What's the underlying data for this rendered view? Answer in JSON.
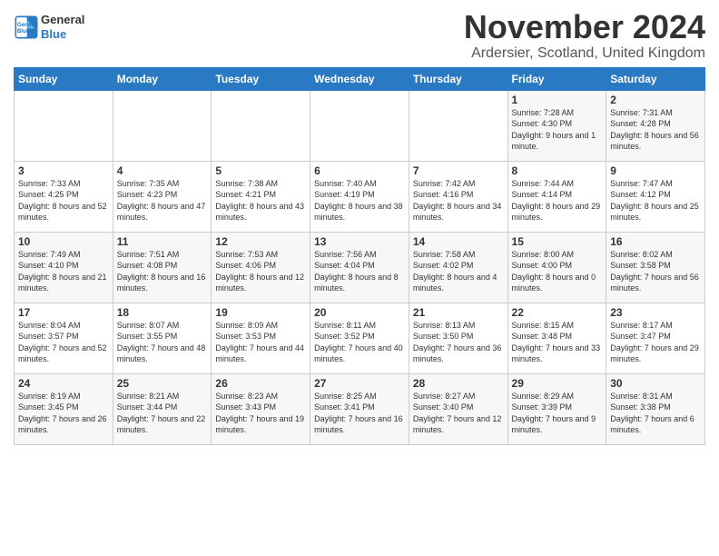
{
  "logo": {
    "line1": "General",
    "line2": "Blue"
  },
  "title": "November 2024",
  "location": "Ardersier, Scotland, United Kingdom",
  "headers": [
    "Sunday",
    "Monday",
    "Tuesday",
    "Wednesday",
    "Thursday",
    "Friday",
    "Saturday"
  ],
  "weeks": [
    [
      {
        "day": "",
        "sunrise": "",
        "sunset": "",
        "daylight": ""
      },
      {
        "day": "",
        "sunrise": "",
        "sunset": "",
        "daylight": ""
      },
      {
        "day": "",
        "sunrise": "",
        "sunset": "",
        "daylight": ""
      },
      {
        "day": "",
        "sunrise": "",
        "sunset": "",
        "daylight": ""
      },
      {
        "day": "",
        "sunrise": "",
        "sunset": "",
        "daylight": ""
      },
      {
        "day": "1",
        "sunrise": "Sunrise: 7:28 AM",
        "sunset": "Sunset: 4:30 PM",
        "daylight": "Daylight: 9 hours and 1 minute."
      },
      {
        "day": "2",
        "sunrise": "Sunrise: 7:31 AM",
        "sunset": "Sunset: 4:28 PM",
        "daylight": "Daylight: 8 hours and 56 minutes."
      }
    ],
    [
      {
        "day": "3",
        "sunrise": "Sunrise: 7:33 AM",
        "sunset": "Sunset: 4:25 PM",
        "daylight": "Daylight: 8 hours and 52 minutes."
      },
      {
        "day": "4",
        "sunrise": "Sunrise: 7:35 AM",
        "sunset": "Sunset: 4:23 PM",
        "daylight": "Daylight: 8 hours and 47 minutes."
      },
      {
        "day": "5",
        "sunrise": "Sunrise: 7:38 AM",
        "sunset": "Sunset: 4:21 PM",
        "daylight": "Daylight: 8 hours and 43 minutes."
      },
      {
        "day": "6",
        "sunrise": "Sunrise: 7:40 AM",
        "sunset": "Sunset: 4:19 PM",
        "daylight": "Daylight: 8 hours and 38 minutes."
      },
      {
        "day": "7",
        "sunrise": "Sunrise: 7:42 AM",
        "sunset": "Sunset: 4:16 PM",
        "daylight": "Daylight: 8 hours and 34 minutes."
      },
      {
        "day": "8",
        "sunrise": "Sunrise: 7:44 AM",
        "sunset": "Sunset: 4:14 PM",
        "daylight": "Daylight: 8 hours and 29 minutes."
      },
      {
        "day": "9",
        "sunrise": "Sunrise: 7:47 AM",
        "sunset": "Sunset: 4:12 PM",
        "daylight": "Daylight: 8 hours and 25 minutes."
      }
    ],
    [
      {
        "day": "10",
        "sunrise": "Sunrise: 7:49 AM",
        "sunset": "Sunset: 4:10 PM",
        "daylight": "Daylight: 8 hours and 21 minutes."
      },
      {
        "day": "11",
        "sunrise": "Sunrise: 7:51 AM",
        "sunset": "Sunset: 4:08 PM",
        "daylight": "Daylight: 8 hours and 16 minutes."
      },
      {
        "day": "12",
        "sunrise": "Sunrise: 7:53 AM",
        "sunset": "Sunset: 4:06 PM",
        "daylight": "Daylight: 8 hours and 12 minutes."
      },
      {
        "day": "13",
        "sunrise": "Sunrise: 7:56 AM",
        "sunset": "Sunset: 4:04 PM",
        "daylight": "Daylight: 8 hours and 8 minutes."
      },
      {
        "day": "14",
        "sunrise": "Sunrise: 7:58 AM",
        "sunset": "Sunset: 4:02 PM",
        "daylight": "Daylight: 8 hours and 4 minutes."
      },
      {
        "day": "15",
        "sunrise": "Sunrise: 8:00 AM",
        "sunset": "Sunset: 4:00 PM",
        "daylight": "Daylight: 8 hours and 0 minutes."
      },
      {
        "day": "16",
        "sunrise": "Sunrise: 8:02 AM",
        "sunset": "Sunset: 3:58 PM",
        "daylight": "Daylight: 7 hours and 56 minutes."
      }
    ],
    [
      {
        "day": "17",
        "sunrise": "Sunrise: 8:04 AM",
        "sunset": "Sunset: 3:57 PM",
        "daylight": "Daylight: 7 hours and 52 minutes."
      },
      {
        "day": "18",
        "sunrise": "Sunrise: 8:07 AM",
        "sunset": "Sunset: 3:55 PM",
        "daylight": "Daylight: 7 hours and 48 minutes."
      },
      {
        "day": "19",
        "sunrise": "Sunrise: 8:09 AM",
        "sunset": "Sunset: 3:53 PM",
        "daylight": "Daylight: 7 hours and 44 minutes."
      },
      {
        "day": "20",
        "sunrise": "Sunrise: 8:11 AM",
        "sunset": "Sunset: 3:52 PM",
        "daylight": "Daylight: 7 hours and 40 minutes."
      },
      {
        "day": "21",
        "sunrise": "Sunrise: 8:13 AM",
        "sunset": "Sunset: 3:50 PM",
        "daylight": "Daylight: 7 hours and 36 minutes."
      },
      {
        "day": "22",
        "sunrise": "Sunrise: 8:15 AM",
        "sunset": "Sunset: 3:48 PM",
        "daylight": "Daylight: 7 hours and 33 minutes."
      },
      {
        "day": "23",
        "sunrise": "Sunrise: 8:17 AM",
        "sunset": "Sunset: 3:47 PM",
        "daylight": "Daylight: 7 hours and 29 minutes."
      }
    ],
    [
      {
        "day": "24",
        "sunrise": "Sunrise: 8:19 AM",
        "sunset": "Sunset: 3:45 PM",
        "daylight": "Daylight: 7 hours and 26 minutes."
      },
      {
        "day": "25",
        "sunrise": "Sunrise: 8:21 AM",
        "sunset": "Sunset: 3:44 PM",
        "daylight": "Daylight: 7 hours and 22 minutes."
      },
      {
        "day": "26",
        "sunrise": "Sunrise: 8:23 AM",
        "sunset": "Sunset: 3:43 PM",
        "daylight": "Daylight: 7 hours and 19 minutes."
      },
      {
        "day": "27",
        "sunrise": "Sunrise: 8:25 AM",
        "sunset": "Sunset: 3:41 PM",
        "daylight": "Daylight: 7 hours and 16 minutes."
      },
      {
        "day": "28",
        "sunrise": "Sunrise: 8:27 AM",
        "sunset": "Sunset: 3:40 PM",
        "daylight": "Daylight: 7 hours and 12 minutes."
      },
      {
        "day": "29",
        "sunrise": "Sunrise: 8:29 AM",
        "sunset": "Sunset: 3:39 PM",
        "daylight": "Daylight: 7 hours and 9 minutes."
      },
      {
        "day": "30",
        "sunrise": "Sunrise: 8:31 AM",
        "sunset": "Sunset: 3:38 PM",
        "daylight": "Daylight: 7 hours and 6 minutes."
      }
    ]
  ]
}
